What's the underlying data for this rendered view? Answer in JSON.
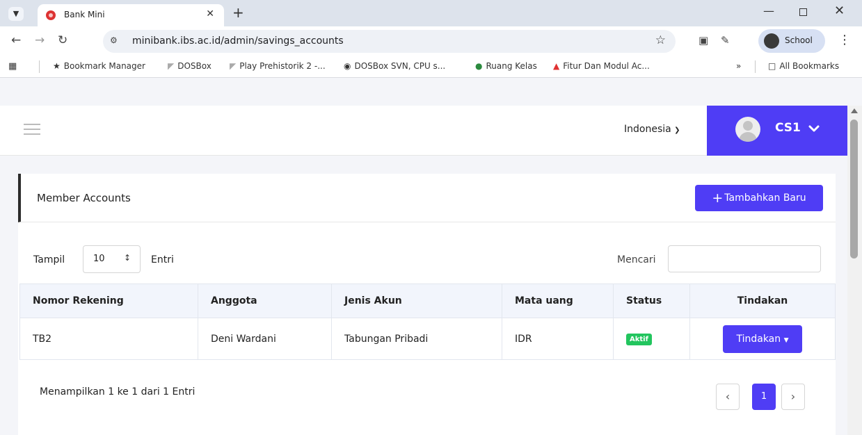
{
  "browser": {
    "tab_title": "Bank Mini",
    "url": "minibank.ibs.ac.id/admin/savings_accounts",
    "profile_label": "School",
    "bookmarks": [
      {
        "label": "Bookmark Manager",
        "icon": "star-icon"
      },
      {
        "label": "DOSBox",
        "icon": "dosbox-icon"
      },
      {
        "label": "Play Prehistorik 2 -...",
        "icon": "game-icon"
      },
      {
        "label": "DOSBox SVN, CPU s...",
        "icon": "invader-icon"
      },
      {
        "label": "Ruang Kelas",
        "icon": "classroom-icon"
      },
      {
        "label": "Fitur Dan Modul Ac...",
        "icon": "flag-icon"
      }
    ],
    "all_bookmarks": "All Bookmarks"
  },
  "header": {
    "language": "Indonesia",
    "user_name": "CS1"
  },
  "card": {
    "title": "Member Accounts",
    "add_button": "Tambahkan Baru",
    "length_label": "Tampil",
    "length_value": "10",
    "length_suffix": "Entri",
    "search_label": "Mencari",
    "search_value": ""
  },
  "table": {
    "columns": [
      "Nomor Rekening",
      "Anggota",
      "Jenis Akun",
      "Mata uang",
      "Status",
      "Tindakan"
    ],
    "rows": [
      {
        "account_no": "TB2",
        "member": "Deni Wardani",
        "type": "Tabungan Pribadi",
        "currency": "IDR",
        "status": "Aktif",
        "action": "Tindakan"
      }
    ]
  },
  "footer": {
    "info": "Menampilkan 1 ke 1 dari 1 Entri",
    "current_page": "1"
  },
  "colors": {
    "primary": "#4f3df5",
    "active_badge": "#22c55e"
  }
}
